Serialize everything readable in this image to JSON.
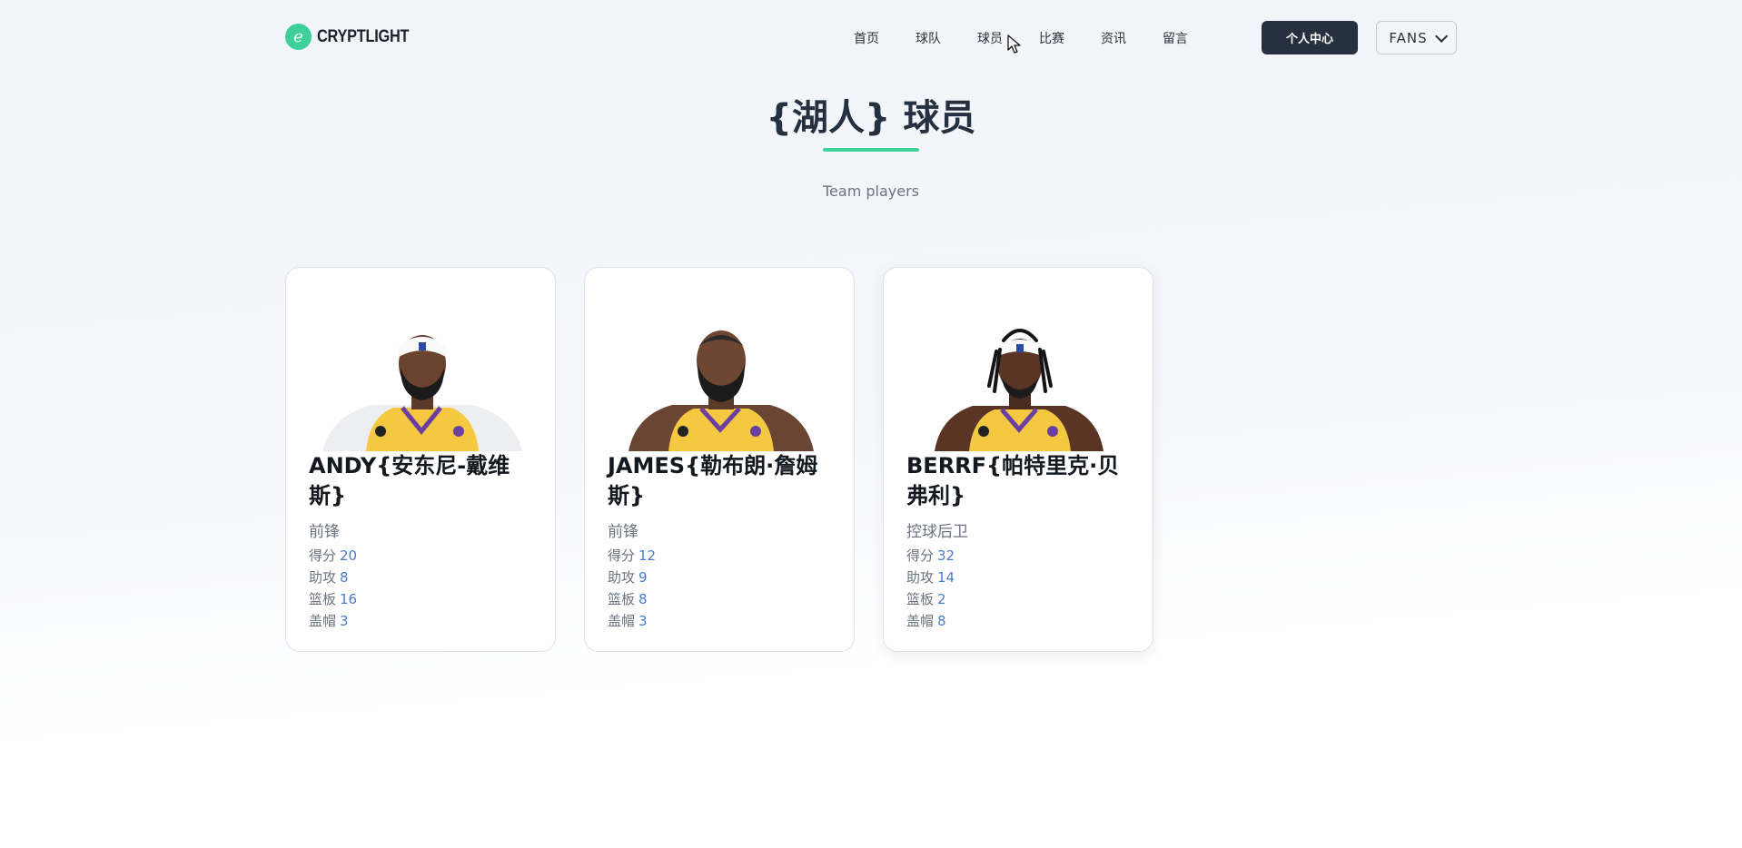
{
  "header": {
    "logo_text": "CRYPTLIGHT",
    "logo_mark": "e",
    "nav": [
      "首页",
      "球队",
      "球员",
      "比赛",
      "资讯",
      "留言"
    ],
    "personal_button": "个人中心",
    "fans_label": "FANS"
  },
  "page": {
    "title": "{湖人} 球员",
    "subtitle": "Team players"
  },
  "players": [
    {
      "name": "ANDY{安东尼-戴维斯}",
      "position": "前锋",
      "stats": [
        {
          "label": "得分",
          "value": "20"
        },
        {
          "label": "助攻",
          "value": "8"
        },
        {
          "label": "篮板",
          "value": "16"
        },
        {
          "label": "盖帽",
          "value": "3"
        }
      ]
    },
    {
      "name": "JAMES{勒布朗·詹姆斯}",
      "position": "前锋",
      "stats": [
        {
          "label": "得分",
          "value": "12"
        },
        {
          "label": "助攻",
          "value": "9"
        },
        {
          "label": "篮板",
          "value": "8"
        },
        {
          "label": "盖帽",
          "value": "3"
        }
      ]
    },
    {
      "name": "BERRF{帕特里克·贝弗利}",
      "position": "控球后卫",
      "stats": [
        {
          "label": "得分",
          "value": "32"
        },
        {
          "label": "助攻",
          "value": "14"
        },
        {
          "label": "篮板",
          "value": "2"
        },
        {
          "label": "盖帽",
          "value": "8"
        }
      ]
    }
  ],
  "colors": {
    "accent": "#3fcf9a",
    "dark_button": "#27303f",
    "stat_value": "#4a7cc9",
    "jersey": "#f5c842",
    "jersey_trim": "#6b3fa0"
  }
}
